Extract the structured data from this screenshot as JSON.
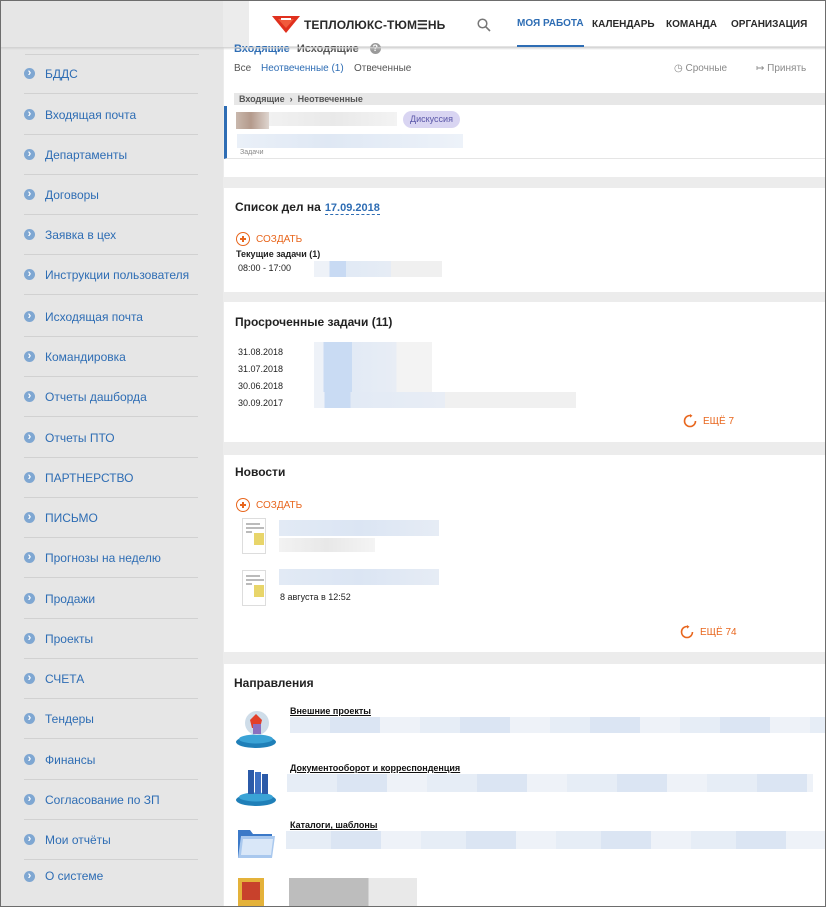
{
  "header": {
    "brand": "ТЕПЛОЛЮКС-ТЮМ☰НЬ",
    "nav": [
      "МОЯ РАБОТА",
      "КАЛЕНДАРЬ",
      "КОМАНДА",
      "ОРГАНИЗАЦИЯ"
    ],
    "active_nav": "МОЯ РАБОТА"
  },
  "sidebar": {
    "items": [
      {
        "label": "БДДС"
      },
      {
        "label": "Входящая почта"
      },
      {
        "label": "Департаменты"
      },
      {
        "label": "Договоры"
      },
      {
        "label": "Заявка в цех"
      },
      {
        "label": "Инструкции пользователя"
      },
      {
        "label": "Исходящая почта"
      },
      {
        "label": "Командировка"
      },
      {
        "label": "Отчеты дашборда"
      },
      {
        "label": "Отчеты ПТО"
      },
      {
        "label": "ПАРТНЕРСТВО"
      },
      {
        "label": "ПИСЬМО"
      },
      {
        "label": "Прогнозы на неделю"
      },
      {
        "label": "Продажи"
      },
      {
        "label": "Проекты"
      },
      {
        "label": "СЧЕТА"
      },
      {
        "label": "Тендеры"
      },
      {
        "label": "Финансы"
      },
      {
        "label": "Согласование по ЗП"
      },
      {
        "label": "Мои отчёты"
      },
      {
        "label": "О системе"
      }
    ]
  },
  "inbox": {
    "tab_incoming": "Входящие",
    "tab_outgoing": "Исходящие",
    "filters": {
      "all": "Все",
      "unanswered": "Неотвеченные (1)",
      "answered": "Отвеченные"
    },
    "tools": {
      "urgent": "Срочные",
      "accept": "Принять"
    },
    "breadcrumb": {
      "root": "Входящие",
      "current": "Неотвеченные"
    },
    "item": {
      "badge": "Дискуссия",
      "sub": "Задачи"
    }
  },
  "todo": {
    "title": "Список дел на",
    "date": "17.09.2018",
    "create": "СОЗДАТЬ",
    "current_label": "Текущие задачи (1)",
    "time": "08:00 - 17:00"
  },
  "overdue": {
    "title": "Просроченные задачи (11)",
    "dates": [
      "31.08.2018",
      "31.07.2018",
      "30.06.2018",
      "30.09.2017"
    ],
    "more": "ЕЩЁ 7"
  },
  "news": {
    "title": "Новости",
    "create": "СОЗДАТЬ",
    "date_2": "8 августа в 12:52",
    "more": "ЕЩЁ 74"
  },
  "directions": {
    "title": "Направления",
    "items": [
      {
        "label": "Внешние проекты",
        "icon": "globe-icon"
      },
      {
        "label": "Документооборот и корреспонденция",
        "icon": "binders-icon"
      },
      {
        "label": "Каталоги, шаблоны",
        "icon": "folder-icon"
      }
    ]
  },
  "colors": {
    "accent": "#2e6db4",
    "orange": "#e8661d",
    "sidebar_bg": "#e6e6e6"
  }
}
